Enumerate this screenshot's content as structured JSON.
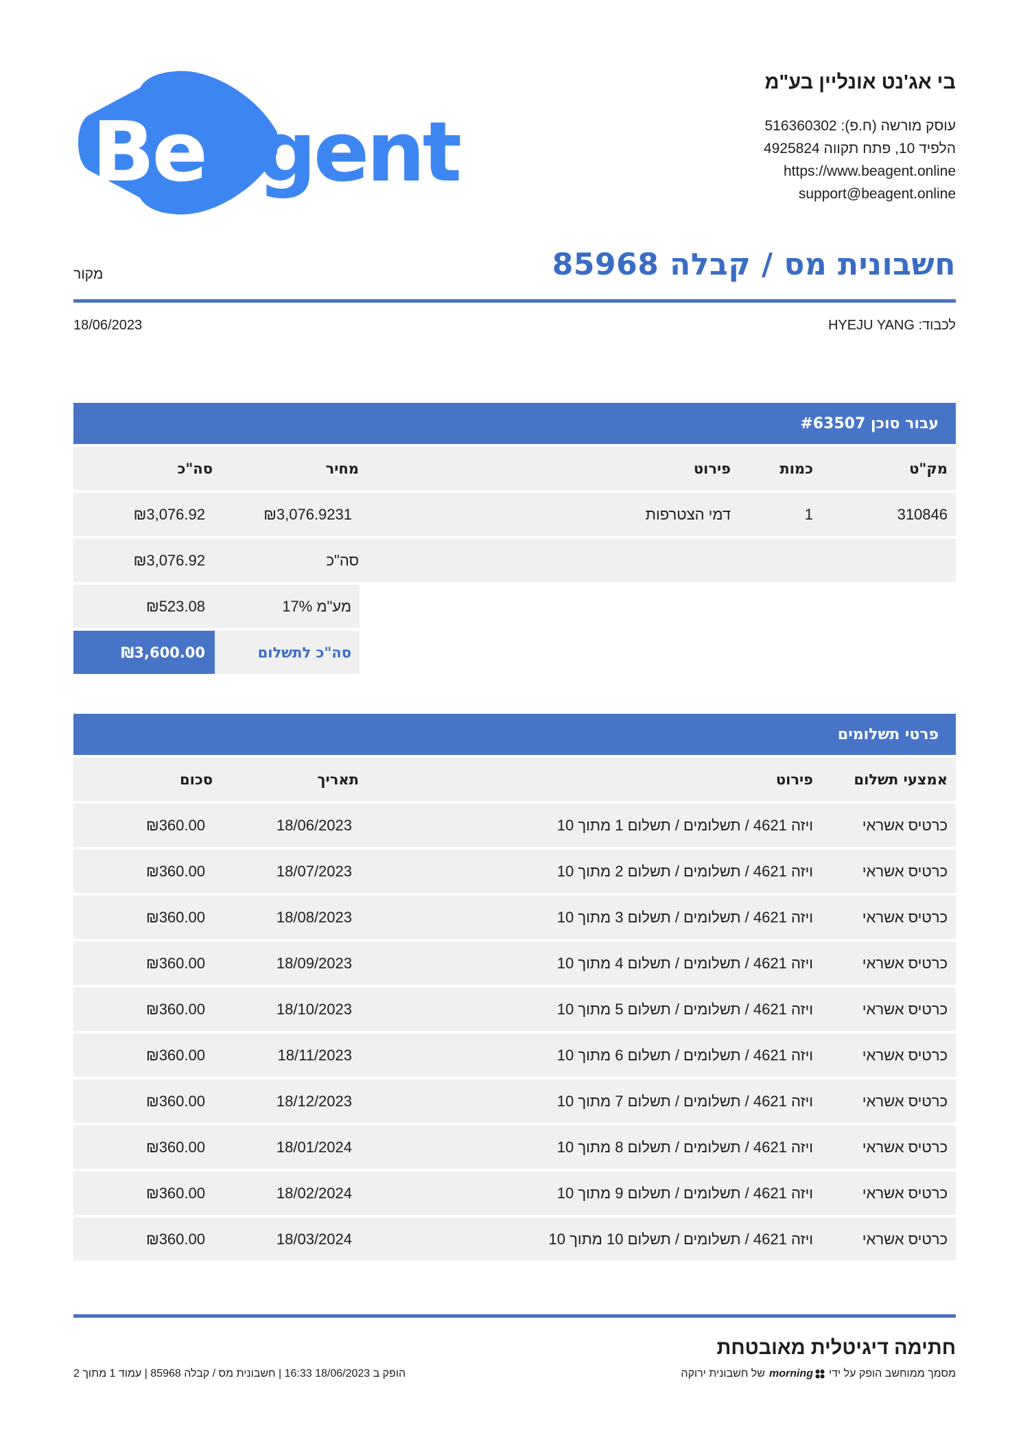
{
  "company": {
    "name": "בי אג'נט אונליין בע\"מ",
    "tax_id": "עוסק מורשה (ח.פ): 516360302",
    "address": "הלפיד 10, פתח תקווה 4925824",
    "website": "https://www.beagent.online",
    "email": "support@beagent.online"
  },
  "logo": {
    "text": "Beagent",
    "color": "#3d86f2"
  },
  "document": {
    "title": "חשבונית מס / קבלה 85968",
    "kind": "מקור",
    "recipient": "לכבוד: HYEJU YANG",
    "date": "18/06/2023"
  },
  "items_section": {
    "title": "עבור סוכן #63507",
    "headers": {
      "sku": "מק\"ט",
      "qty": "כמות",
      "description": "פירוט",
      "price": "מחיר",
      "total": "סה\"כ"
    },
    "rows": [
      {
        "sku": "310846",
        "qty": "1",
        "description": "דמי הצטרפות",
        "price": "₪3,076.9231",
        "total": "₪3,076.92"
      }
    ],
    "subtotal_label": "סה\"כ",
    "subtotal_value": "₪3,076.92",
    "vat_label": "מע\"מ 17%",
    "vat_value": "₪523.08",
    "grand_total_label": "סה\"כ לתשלום",
    "grand_total_value": "₪3,600.00"
  },
  "payments_section": {
    "title": "פרטי תשלומים",
    "headers": {
      "method": "אמצעי תשלום",
      "description": "פירוט",
      "date": "תאריך",
      "amount": "סכום"
    },
    "rows": [
      {
        "method": "כרטיס אשראי",
        "description": "ויזה 4621 / תשלומים / תשלום 1 מתוך 10",
        "date": "18/06/2023",
        "amount": "₪360.00"
      },
      {
        "method": "כרטיס אשראי",
        "description": "ויזה 4621 / תשלומים / תשלום 2 מתוך 10",
        "date": "18/07/2023",
        "amount": "₪360.00"
      },
      {
        "method": "כרטיס אשראי",
        "description": "ויזה 4621 / תשלומים / תשלום 3 מתוך 10",
        "date": "18/08/2023",
        "amount": "₪360.00"
      },
      {
        "method": "כרטיס אשראי",
        "description": "ויזה 4621 / תשלומים / תשלום 4 מתוך 10",
        "date": "18/09/2023",
        "amount": "₪360.00"
      },
      {
        "method": "כרטיס אשראי",
        "description": "ויזה 4621 / תשלומים / תשלום 5 מתוך 10",
        "date": "18/10/2023",
        "amount": "₪360.00"
      },
      {
        "method": "כרטיס אשראי",
        "description": "ויזה 4621 / תשלומים / תשלום 6 מתוך 10",
        "date": "18/11/2023",
        "amount": "₪360.00"
      },
      {
        "method": "כרטיס אשראי",
        "description": "ויזה 4621 / תשלומים / תשלום 7 מתוך 10",
        "date": "18/12/2023",
        "amount": "₪360.00"
      },
      {
        "method": "כרטיס אשראי",
        "description": "ויזה 4621 / תשלומים / תשלום 8 מתוך 10",
        "date": "18/01/2024",
        "amount": "₪360.00"
      },
      {
        "method": "כרטיס אשראי",
        "description": "ויזה 4621 / תשלומים / תשלום 9 מתוך 10",
        "date": "18/02/2024",
        "amount": "₪360.00"
      },
      {
        "method": "כרטיס אשראי",
        "description": "ויזה 4621 / תשלומים / תשלום 10 מתוך 10",
        "date": "18/03/2024",
        "amount": "₪360.00"
      }
    ]
  },
  "footer": {
    "signature_title": "חתימה דיגיטלית מאובטחת",
    "signature_prefix": "מסמך ממוחשב הופק על ידי",
    "signature_brand": "morning",
    "signature_suffix": "של חשבונית ירוקה",
    "meta": "הופק ב 18/06/2023 16:33 | חשבונית מס / קבלה 85968 | עמוד 1 מתוך 2"
  },
  "colors": {
    "accent": "#4874c8",
    "title_blue": "#3a6cc4",
    "row_bg": "#f0f0f0"
  }
}
